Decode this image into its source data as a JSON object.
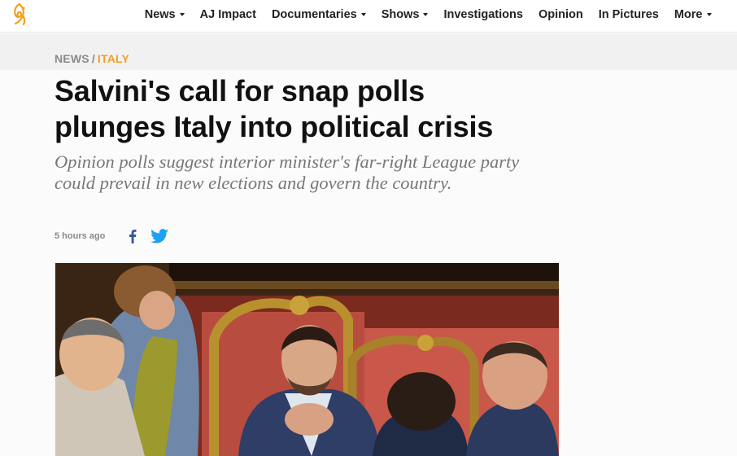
{
  "nav": {
    "logo_icon": "al-jazeera-logo",
    "items": [
      {
        "label": "News",
        "dropdown": true
      },
      {
        "label": "AJ Impact",
        "dropdown": false
      },
      {
        "label": "Documentaries",
        "dropdown": true
      },
      {
        "label": "Shows",
        "dropdown": true
      },
      {
        "label": "Investigations",
        "dropdown": false
      },
      {
        "label": "Opinion",
        "dropdown": false
      },
      {
        "label": "In Pictures",
        "dropdown": false
      },
      {
        "label": "More",
        "dropdown": true
      }
    ]
  },
  "breadcrumb": {
    "section": "NEWS",
    "separator": "/",
    "topic": "ITALY"
  },
  "article": {
    "headline_line1": "Salvini's call for snap polls",
    "headline_line2": "plunges Italy into political crisis",
    "standfirst": "Opinion polls suggest interior minister's far-right League party could prevail in new elections and govern the country.",
    "timestamp": "5 hours ago"
  },
  "share": {
    "facebook_icon": "facebook-icon",
    "twitter_icon": "twitter-icon"
  },
  "colors": {
    "accent": "#f4a021",
    "twitter": "#1da1f2",
    "facebook": "#3b5998"
  }
}
